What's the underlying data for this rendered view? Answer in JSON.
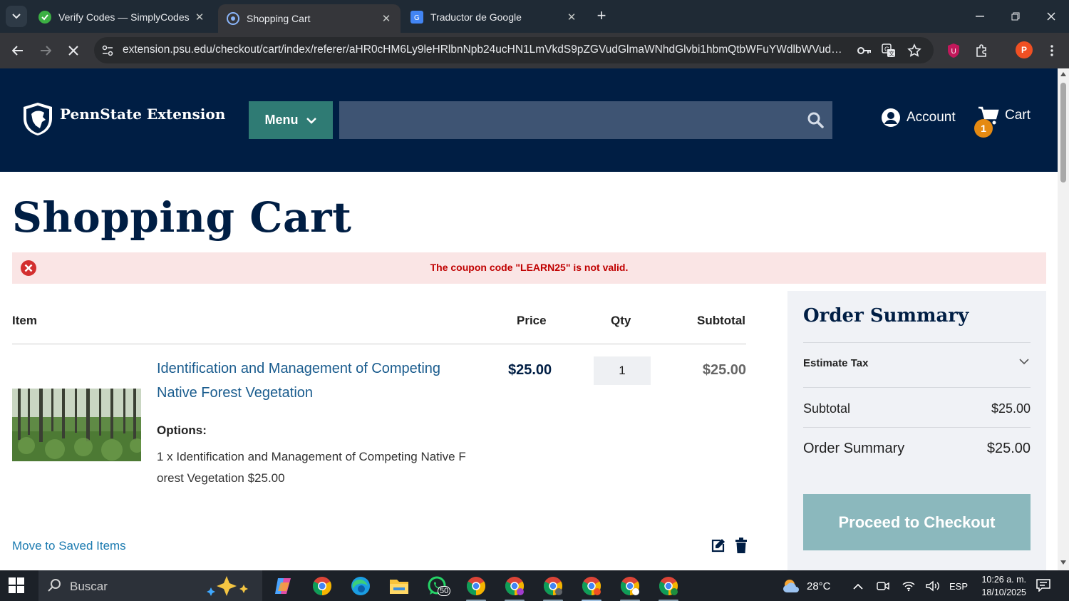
{
  "browser": {
    "tabs": [
      {
        "title": "Verify Codes — SimplyCodes",
        "active": false
      },
      {
        "title": "Shopping Cart",
        "active": true
      },
      {
        "title": "Traductor de Google",
        "active": false
      }
    ],
    "url": "extension.psu.edu/checkout/cart/index/referer/aHR0cHM6Ly9leHRlbnNpb24ucHN1LmVkdS9pZGVudGlmaWNhdGlvbi1hbmQtbWFuYWdlbWVudC1v...",
    "profile_initial": "P"
  },
  "site": {
    "brand": "PennState Extension",
    "menu_label": "Menu",
    "search_placeholder": "",
    "account_label": "Account",
    "cart_label": "Cart",
    "cart_count": "1",
    "colors": {
      "header": "#001e44",
      "menu": "#2f7b74",
      "accent": "#e58a12"
    }
  },
  "page": {
    "title": "Shopping Cart",
    "alert": "The coupon code \"LEARN25\" is not valid.",
    "table_headers": {
      "item": "Item",
      "price": "Price",
      "qty": "Qty",
      "subtotal": "Subtotal"
    },
    "item": {
      "name": "Identification and Management of Competing Native Forest Vegetation",
      "options_label": "Options:",
      "option_value": "1 x Identification and Management of Competing Native F orest Vegetation $25.00",
      "price": "$25.00",
      "qty": "1",
      "subtotal": "$25.00"
    },
    "move_to_saved": "Move to Saved Items"
  },
  "summary": {
    "title": "Order Summary",
    "estimate_tax": "Estimate Tax",
    "subtotal_label": "Subtotal",
    "subtotal_value": "$25.00",
    "total_label": "Order Summary",
    "total_value": "$25.00",
    "checkout_label": "Proceed to Checkout"
  },
  "taskbar": {
    "search_label": "Buscar",
    "whatsapp_badge": "50",
    "weather": "28°C",
    "language": "ESP",
    "time": "10:26 a. m.",
    "date": "18/10/2025"
  }
}
